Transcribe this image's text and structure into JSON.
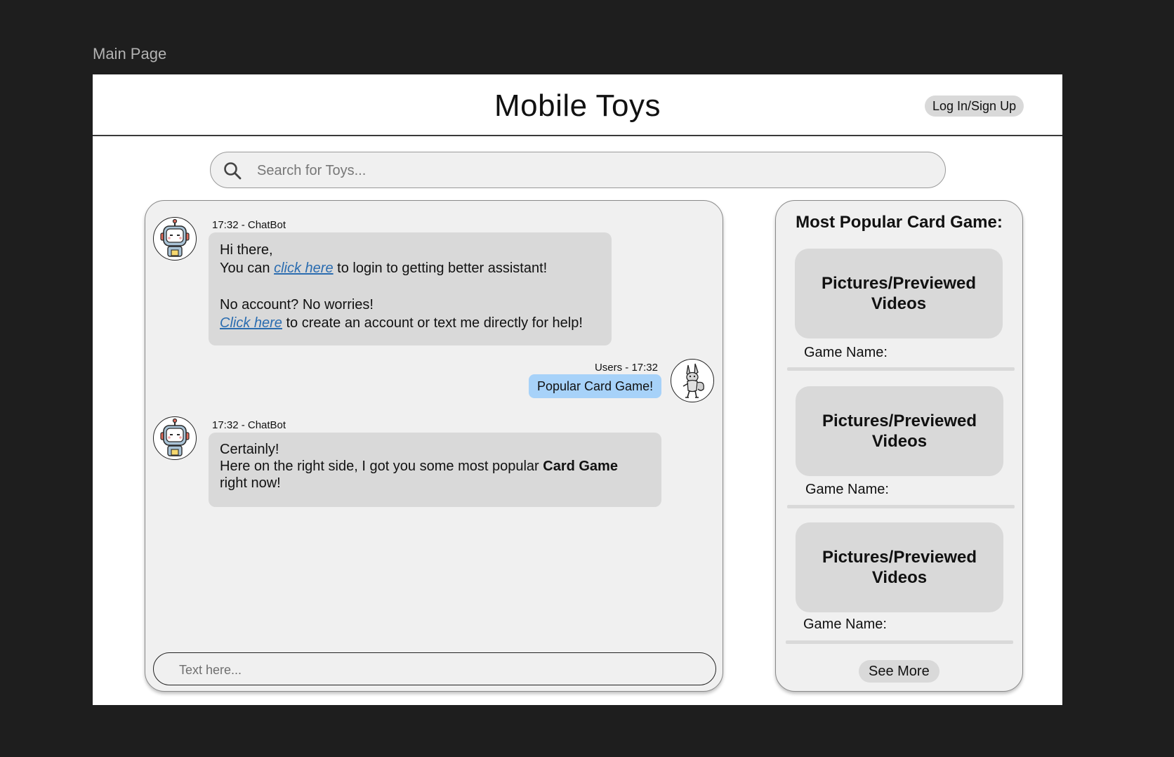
{
  "frame_label": "Main Page",
  "header": {
    "title": "Mobile Toys",
    "login_label": "Log In/Sign Up"
  },
  "search": {
    "placeholder": "Search for Toys..."
  },
  "chat": {
    "messages": [
      {
        "meta": "17:32 - ChatBot",
        "line1": "Hi there,",
        "line2_pre": "You can ",
        "line2_link": "click here",
        "line2_post": " to login to getting better assistant!",
        "line3": "No account? No worries!",
        "line4_link": "Click here",
        "line4_post": " to create an account or text me directly for help!"
      },
      {
        "meta": "Users - 17:32",
        "text": "Popular Card Game!"
      },
      {
        "meta": "17:32 - ChatBot",
        "line1": "Certainly!",
        "line2_pre": "Here on the right side, I got you some most popular ",
        "line2_bold": "Card Game",
        "line3": "right now!"
      }
    ],
    "input_placeholder": "Text here..."
  },
  "sidebar": {
    "title": "Most Popular Card Game:",
    "cards": [
      {
        "media_label": "Pictures/Previewed Videos",
        "name_label": "Game Name:"
      },
      {
        "media_label": "Pictures/Previewed Videos",
        "name_label": "Game Name:"
      },
      {
        "media_label": "Pictures/Previewed Videos",
        "name_label": "Game Name:"
      }
    ],
    "see_more_label": "See More"
  },
  "icons": {
    "search": "search-icon",
    "bot_avatar": "robot-icon",
    "user_avatar": "rabbit-icon"
  },
  "colors": {
    "background": "#1e1e1e",
    "panel": "#f0f0f0",
    "bubble": "#d9d9d9",
    "user_bubble": "#a7d2f9",
    "link": "#2a6cb0"
  }
}
